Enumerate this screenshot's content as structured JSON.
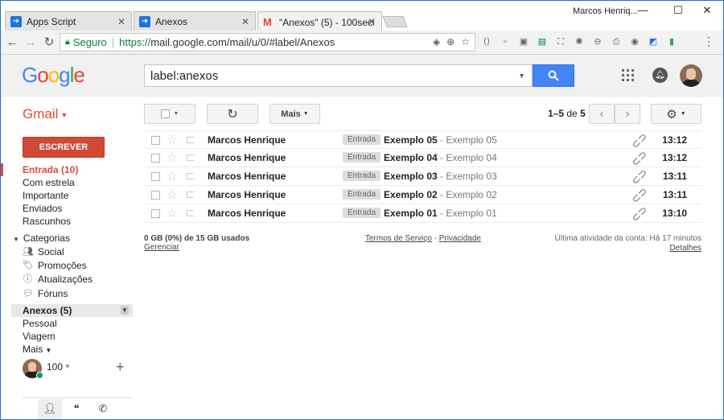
{
  "browser": {
    "tabs": [
      {
        "title": "Apps Script",
        "favicon": "apps-script-icon"
      },
      {
        "title": "Anexos",
        "favicon": "apps-script-icon"
      },
      {
        "title": "\"Anexos\" (5) - 100securit",
        "favicon": "gmail-icon"
      }
    ],
    "window_user": "Marcos Henriq...",
    "secure_label": "Seguro",
    "url_scheme": "https://",
    "url_rest": "mail.google.com/mail/u/0/#label/Anexos"
  },
  "header": {
    "logo": [
      "G",
      "o",
      "o",
      "g",
      "l",
      "e"
    ],
    "search_value": "label:anexos"
  },
  "toolbar": {
    "app_label": "Gmail",
    "more_label": "Mais",
    "pager_range": "1–5",
    "pager_of": "de",
    "pager_total": "5"
  },
  "sidebar": {
    "compose": "ESCREVER",
    "items": [
      {
        "label": "Entrada (10)"
      },
      {
        "label": "Com estrela"
      },
      {
        "label": "Importante"
      },
      {
        "label": "Enviados"
      },
      {
        "label": "Rascunhos"
      }
    ],
    "categories_label": "Categorias",
    "categories": [
      {
        "label": "Social",
        "icon": "people-icon"
      },
      {
        "label": "Promoções",
        "icon": "tag-icon"
      },
      {
        "label": "Atualizações",
        "icon": "info-icon"
      },
      {
        "label": "Fóruns",
        "icon": "forum-icon"
      }
    ],
    "selected_label": "Anexos (5)",
    "labels": [
      {
        "label": "Pessoal"
      },
      {
        "label": "Viagem"
      }
    ],
    "more_label": "Mais",
    "hangouts_name": "100"
  },
  "messages": [
    {
      "sender": "Marcos Henrique",
      "label": "Entrada",
      "subject": "Exemplo 05",
      "snippet": " - Exemplo 05",
      "time": "13:12"
    },
    {
      "sender": "Marcos Henrique",
      "label": "Entrada",
      "subject": "Exemplo 04",
      "snippet": " - Exemplo 04",
      "time": "13:12"
    },
    {
      "sender": "Marcos Henrique",
      "label": "Entrada",
      "subject": "Exemplo 03",
      "snippet": " - Exemplo 03",
      "time": "13:11"
    },
    {
      "sender": "Marcos Henrique",
      "label": "Entrada",
      "subject": "Exemplo 02",
      "snippet": " - Exemplo 02",
      "time": "13:11"
    },
    {
      "sender": "Marcos Henrique",
      "label": "Entrada",
      "subject": "Exemplo 01",
      "snippet": " - Exemplo 01",
      "time": "13:10"
    }
  ],
  "footer": {
    "storage": "0 GB (0%) de 15 GB usados",
    "manage": "Gerenciar",
    "terms": "Termos de Serviço",
    "dash": " - ",
    "privacy": "Privacidade",
    "activity": "Última atividade da conta: Há 17 minutos",
    "details": "Detalhes"
  },
  "colors": {
    "accent_red": "#dd4b39",
    "search_blue": "#4285f4",
    "secure_green": "#0b8043"
  }
}
